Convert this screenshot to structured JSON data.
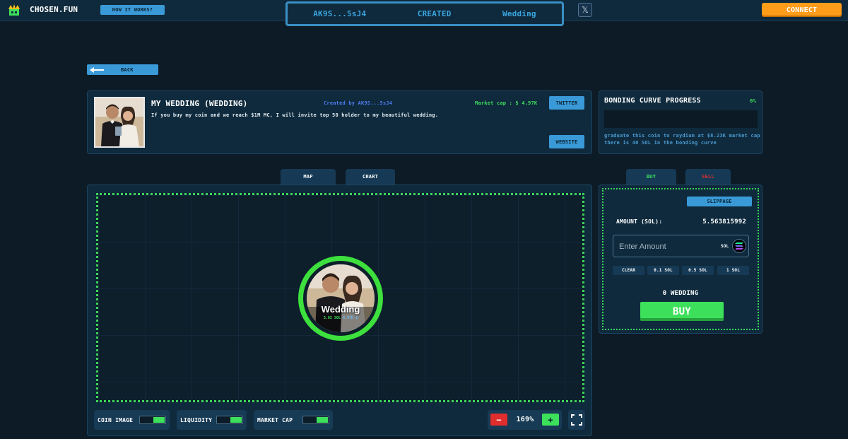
{
  "header": {
    "brand": "CHOSEN.FUN",
    "how_it_works": "HOW IT WORKS?",
    "address": "AK9S...5sJ4",
    "status": "CREATED",
    "coin_name": "Wedding",
    "x_label": "𝕏",
    "connect": "CONNECT"
  },
  "back_label": "BACK",
  "coin": {
    "title": "MY WEDDING (WEDDING)",
    "description": "If you buy my coin and we reach $1M MC, I will invite top 50 holder to my beautiful wedding.",
    "created_by": "Created by AK9S...5sJ4",
    "market_cap": "Market cap : $ 4.97K",
    "twitter": "TWITTER",
    "website": "WEBSITE"
  },
  "bonding": {
    "title": "BONDING CURVE PROGRESS",
    "percent": "0%",
    "progress": 0,
    "note_line1": "graduate this coin to raydium at $8.23K market cap",
    "note_line2": "there is 40 SOL in the bonding curve"
  },
  "tabs": {
    "map": "MAP",
    "chart": "CHART",
    "buy": "BUY",
    "sell": "SELL"
  },
  "map": {
    "bubble_name": "Wedding",
    "bubble_sol": "3.82 SOL",
    "bubble_mcap": "4.97K $",
    "coin_image_label": "COIN IMAGE",
    "liquidity_label": "LIQUIDITY",
    "market_cap_label": "MARKET CAP",
    "zoom_minus": "−",
    "zoom_plus": "+",
    "zoom_level": "169%"
  },
  "trade": {
    "slippage": "SLIPPAGE",
    "amount_label": "AMOUNT (SOL):",
    "amount_value": "5.563815992",
    "input_placeholder": "Enter Amount",
    "unit": "SOL",
    "quick": [
      "CLEAR",
      "0.1 SOL",
      "0.5 SOL",
      "1 SOL"
    ],
    "receive": "0 WEDDING",
    "buy_button": "BUY"
  },
  "colors": {
    "background": "#0d1b26",
    "panel": "#0f2a3d",
    "accent_blue": "#3a9ad8",
    "accent_green": "#3de05a",
    "connect_orange": "#ff9c1a",
    "sell_red": "#e02d2d"
  },
  "icons": [
    "crown-icon",
    "x-logo-icon",
    "arrow-left-icon",
    "solana-icon",
    "fullscreen-icon"
  ]
}
